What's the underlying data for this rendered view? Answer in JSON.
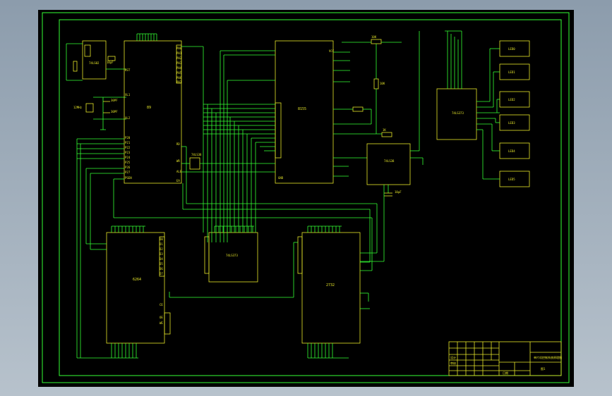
{
  "chips": {
    "mcu": "89",
    "eprom": "2732",
    "latch": "74LS373",
    "ram": "6264",
    "cpld": "8155",
    "decoder": "74LS38",
    "logic": "74LS02"
  },
  "rows": {
    "display_boxes": [
      "LED0",
      "LED1",
      "LED2",
      "LED3",
      "LED4",
      "LED5"
    ]
  },
  "title_block": {
    "drawing_title": "单片机控制系统原理图",
    "sheet_no": "图1",
    "date_cells": [
      "设计",
      "审核",
      "日期"
    ]
  },
  "passives": {
    "crystal": "12MHz",
    "cap1": "30PF",
    "cap2": "30PF",
    "cap3": "10μF",
    "cap4": "10μF",
    "res1": "10K",
    "res2": "10K",
    "res3": "1K"
  },
  "pins": {
    "mcu_left": [
      "RST",
      "XL1",
      "XL2",
      "P20",
      "P21",
      "P22",
      "P23",
      "P24",
      "P25",
      "P26",
      "P27",
      "PSEN"
    ],
    "mcu_right": [
      "P00",
      "P01",
      "P02",
      "P03",
      "P04",
      "P05",
      "P06",
      "P07",
      "RD",
      "WR",
      "ALE",
      "EA"
    ],
    "ram_left": [
      "A0",
      "A1",
      "A2",
      "A3",
      "A4",
      "A5",
      "A6",
      "A7",
      "A8"
    ],
    "ram_right": [
      "D0",
      "D1",
      "D2",
      "D3",
      "D4",
      "D5",
      "D6",
      "D7"
    ],
    "misc": [
      "VCC",
      "GND",
      "CE",
      "OE",
      "WE"
    ]
  }
}
